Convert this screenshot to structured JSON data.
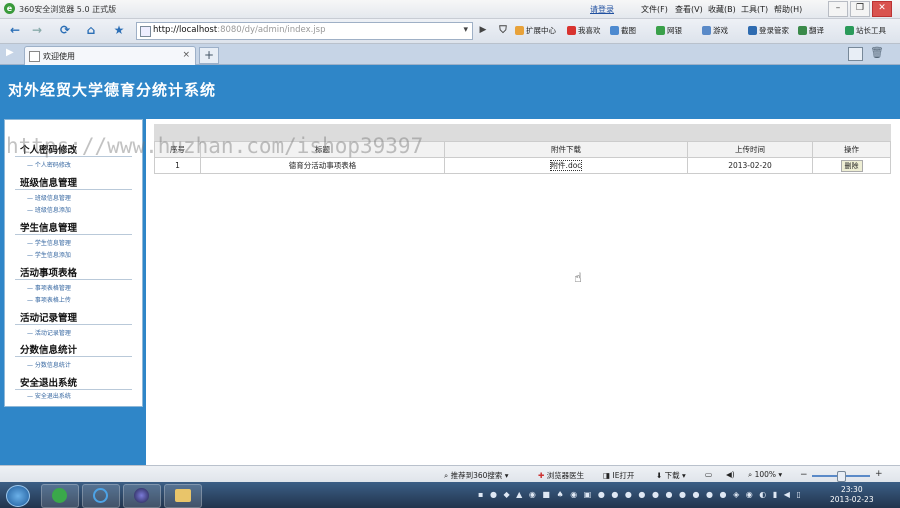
{
  "browser": {
    "title": "360安全浏览器 5.0 正式版",
    "login_link": "请登录",
    "menus": [
      "文件(F)",
      "查看(V)",
      "收藏(B)",
      "工具(T)",
      "帮助(H)"
    ],
    "address_host": "http://localhost",
    "address_rest": ":8080/dy/admin/index.jsp",
    "extensions": [
      "扩展中心",
      "我喜欢",
      "截图",
      "网银",
      "游戏",
      "登录管家",
      "翻译",
      "站长工具"
    ],
    "tab_title": "欢迎使用",
    "window_buttons": [
      "–",
      "❐",
      "✕"
    ]
  },
  "app": {
    "system_title": "对外经贸大学德育分统计系统",
    "watermark": "https://www.huzhan.com/ishop39397",
    "menu_groups": [
      {
        "label": "个人密码修改",
        "items": [
          "个人密码修改"
        ]
      },
      {
        "label": "班级信息管理",
        "items": [
          "班级信息管理",
          "班级信息添加"
        ]
      },
      {
        "label": "学生信息管理",
        "items": [
          "学生信息管理",
          "学生信息添加"
        ]
      },
      {
        "label": "活动事项表格",
        "items": [
          "事项表格管理",
          "事项表格上传"
        ]
      },
      {
        "label": "活动记录管理",
        "items": [
          "活动记录管理"
        ]
      },
      {
        "label": "分数信息统计",
        "items": [
          "分数信息统计"
        ]
      },
      {
        "label": "安全退出系统",
        "items": [
          "安全退出系统"
        ]
      }
    ],
    "table": {
      "headers": [
        "序号",
        "标题",
        "附件下载",
        "上传时间",
        "操作"
      ],
      "rows": [
        {
          "index": "1",
          "title": "德育分活动事项表格",
          "attachment": "附件.doc",
          "upload_time": "2013-02-20",
          "action": "删除"
        }
      ]
    }
  },
  "statusbar": {
    "items": [
      "推荐到360搜索",
      "浏览器医生",
      "下载",
      "100%"
    ],
    "ie_open": "IE打开"
  },
  "taskbar": {
    "time": "23:30",
    "date": "2013-02-23"
  }
}
